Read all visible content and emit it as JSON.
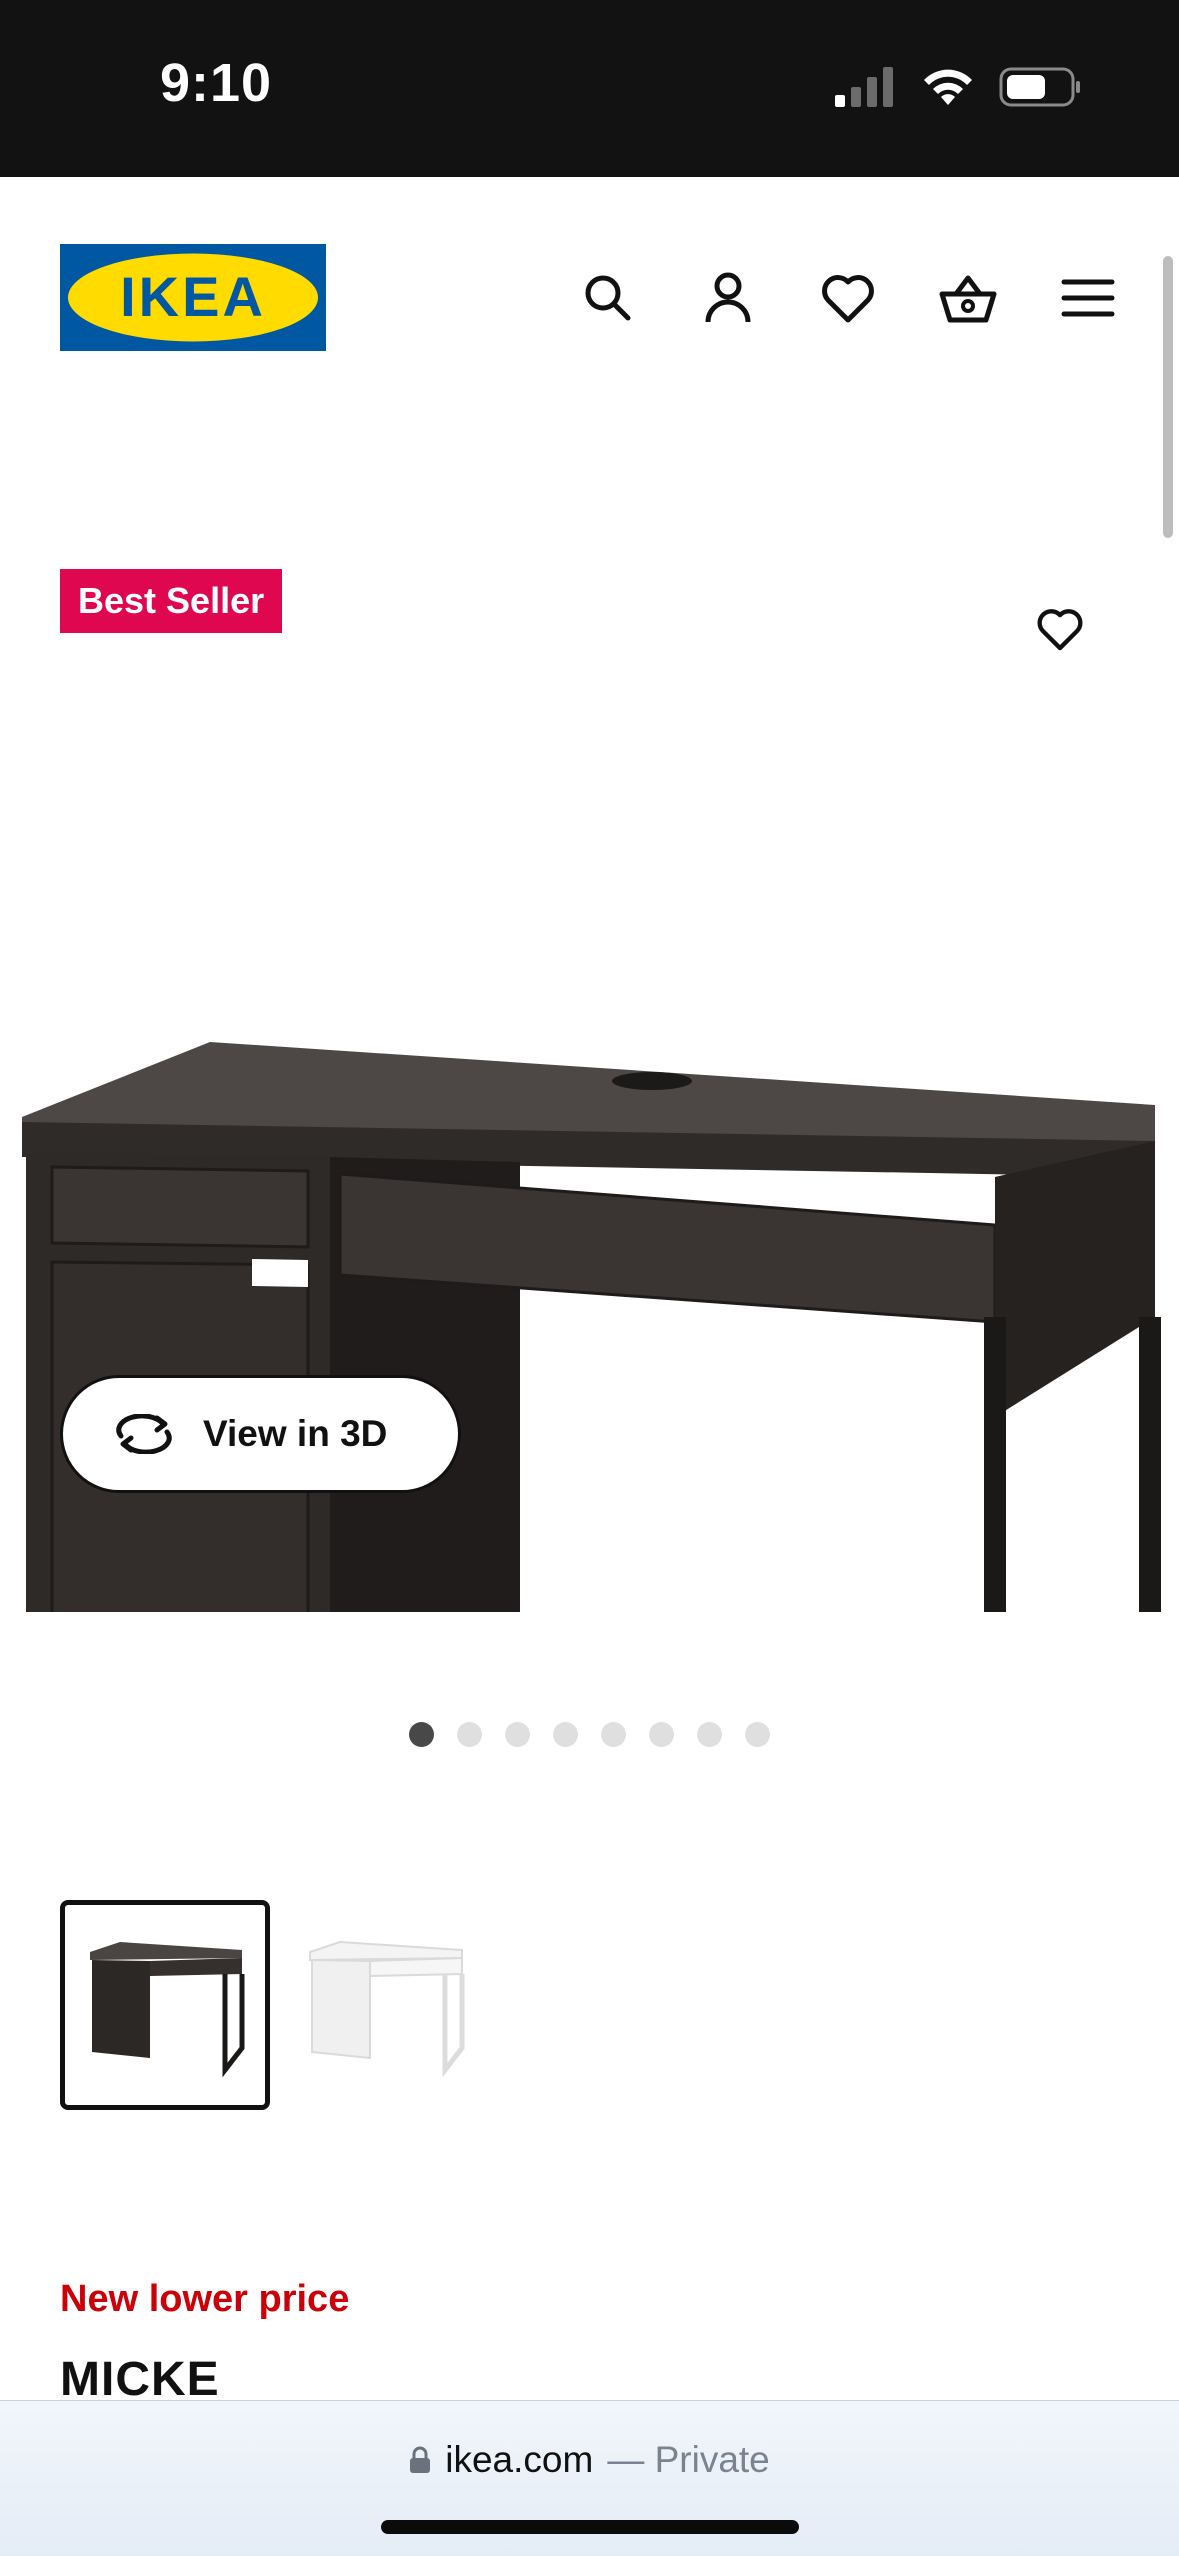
{
  "status_bar": {
    "time": "9:10"
  },
  "header": {
    "logo_text": "IKEA",
    "icons": [
      "search-icon",
      "account-icon",
      "heart-icon",
      "cart-icon",
      "menu-icon"
    ],
    "brand_blue": "#0058a3",
    "brand_yellow": "#ffdb00"
  },
  "gallery": {
    "badge": "Best Seller",
    "view3d_label": "View in 3D",
    "slide_count": 8,
    "active_slide": 1
  },
  "variants": [
    {
      "name": "black-brown",
      "selected": true
    },
    {
      "name": "white",
      "selected": false
    }
  ],
  "product": {
    "promo": "New lower price",
    "name": "MICKE"
  },
  "browser": {
    "host": "ikea.com",
    "mode": "— Private"
  },
  "colors": {
    "badge": "#e00751",
    "promo": "#cc0008"
  }
}
